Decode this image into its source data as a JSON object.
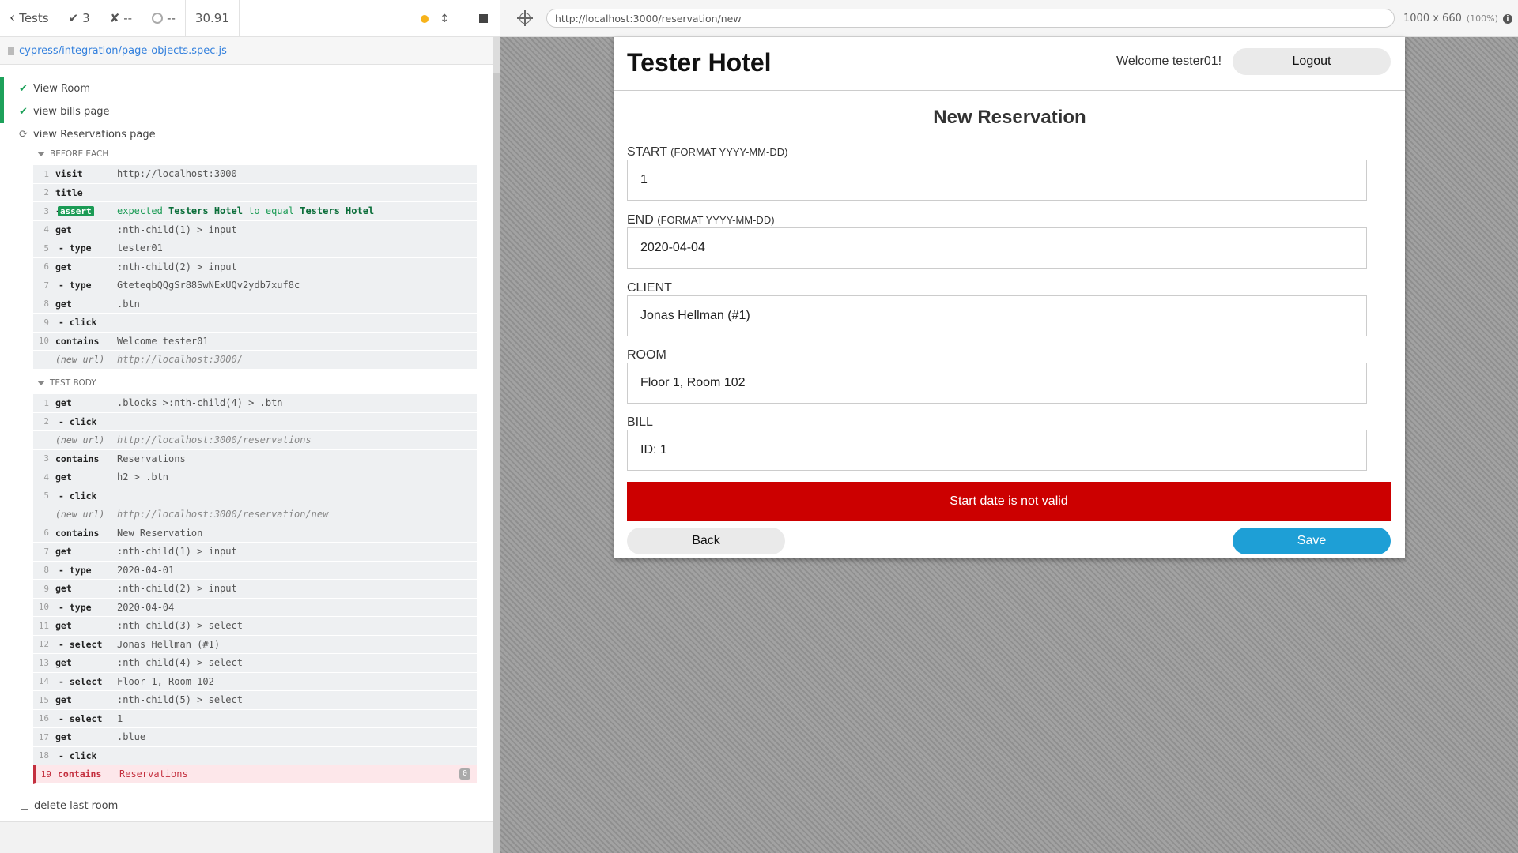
{
  "reporter": {
    "stats": {
      "tests_label": "Tests",
      "passed": "3",
      "failed": "--",
      "pending": "--",
      "duration": "30.91"
    },
    "spec_file": "cypress/integration/page-objects.spec.js",
    "tests": [
      {
        "label": "View Room",
        "state": "passed"
      },
      {
        "label": "view bills page",
        "state": "passed"
      },
      {
        "label": "view Reservations page",
        "state": "running"
      },
      {
        "label": "delete last room",
        "state": "pending"
      }
    ],
    "before_each_label": "BEFORE EACH",
    "test_body_label": "TEST BODY",
    "before_each": [
      {
        "num": "1",
        "name": "visit",
        "msg": "http://localhost:3000"
      },
      {
        "num": "2",
        "name": "title",
        "msg": ""
      },
      {
        "num": "3",
        "name": "assert",
        "msg_pre": "expected",
        "msg_a": "Testers Hotel",
        "msg_mid": "to equal",
        "msg_b": "Testers Hotel"
      },
      {
        "num": "4",
        "name": "get",
        "msg": ":nth-child(1) > input"
      },
      {
        "num": "5",
        "name": "- type",
        "msg": "tester01"
      },
      {
        "num": "6",
        "name": "get",
        "msg": ":nth-child(2) > input"
      },
      {
        "num": "7",
        "name": "- type",
        "msg": "GteteqbQQgSr88SwNExUQv2ydb7xuf8c"
      },
      {
        "num": "8",
        "name": "get",
        "msg": ".btn"
      },
      {
        "num": "9",
        "name": "- click",
        "msg": ""
      },
      {
        "num": "10",
        "name": "contains",
        "msg": "Welcome tester01"
      },
      {
        "num": "",
        "name": "(new url)",
        "msg": "http://localhost:3000/"
      }
    ],
    "test_body": [
      {
        "num": "1",
        "name": "get",
        "msg": ".blocks >:nth-child(4) > .btn"
      },
      {
        "num": "2",
        "name": "- click",
        "msg": ""
      },
      {
        "num": "",
        "name": "(new url)",
        "msg": "http://localhost:3000/reservations"
      },
      {
        "num": "3",
        "name": "contains",
        "msg": "Reservations"
      },
      {
        "num": "4",
        "name": "get",
        "msg": "h2 > .btn"
      },
      {
        "num": "5",
        "name": "- click",
        "msg": ""
      },
      {
        "num": "",
        "name": "(new url)",
        "msg": "http://localhost:3000/reservation/new"
      },
      {
        "num": "6",
        "name": "contains",
        "msg": "New Reservation"
      },
      {
        "num": "7",
        "name": "get",
        "msg": ":nth-child(1) > input"
      },
      {
        "num": "8",
        "name": "- type",
        "msg": "2020-04-01"
      },
      {
        "num": "9",
        "name": "get",
        "msg": ":nth-child(2) > input"
      },
      {
        "num": "10",
        "name": "- type",
        "msg": "2020-04-04"
      },
      {
        "num": "11",
        "name": "get",
        "msg": ":nth-child(3) > select"
      },
      {
        "num": "12",
        "name": "- select",
        "msg": "Jonas Hellman (#1)"
      },
      {
        "num": "13",
        "name": "get",
        "msg": ":nth-child(4) > select"
      },
      {
        "num": "14",
        "name": "- select",
        "msg": "Floor 1, Room 102"
      },
      {
        "num": "15",
        "name": "get",
        "msg": ":nth-child(5) > select"
      },
      {
        "num": "16",
        "name": "- select",
        "msg": "1"
      },
      {
        "num": "17",
        "name": "get",
        "msg": ".blue"
      },
      {
        "num": "18",
        "name": "- click",
        "msg": ""
      },
      {
        "num": "19",
        "name": "contains",
        "msg": "Reservations",
        "badge": "0"
      }
    ]
  },
  "browser": {
    "url": "http://localhost:3000/reservation/new",
    "viewport": "1000 x 660",
    "zoom": "(100%)"
  },
  "app": {
    "brand": "Tester Hotel",
    "welcome": "Welcome tester01!",
    "logout_label": "Logout",
    "page_heading": "New Reservation",
    "fields": [
      {
        "label": "START",
        "hint": "(FORMAT YYYY-MM-DD)",
        "value": "1"
      },
      {
        "label": "END",
        "hint": "(FORMAT YYYY-MM-DD)",
        "value": "2020-04-04"
      },
      {
        "label": "CLIENT",
        "hint": "",
        "value": "Jonas Hellman (#1)"
      },
      {
        "label": "ROOM",
        "hint": "",
        "value": "Floor 1, Room 102"
      },
      {
        "label": "BILL",
        "hint": "",
        "value": "ID: 1"
      }
    ],
    "error": "Start date is not valid",
    "back_label": "Back",
    "save_label": "Save"
  },
  "colors": {
    "pass": "#1da15a",
    "fail": "#c4303f",
    "error_banner": "#cc0000",
    "save_button": "#1e9fd6"
  }
}
